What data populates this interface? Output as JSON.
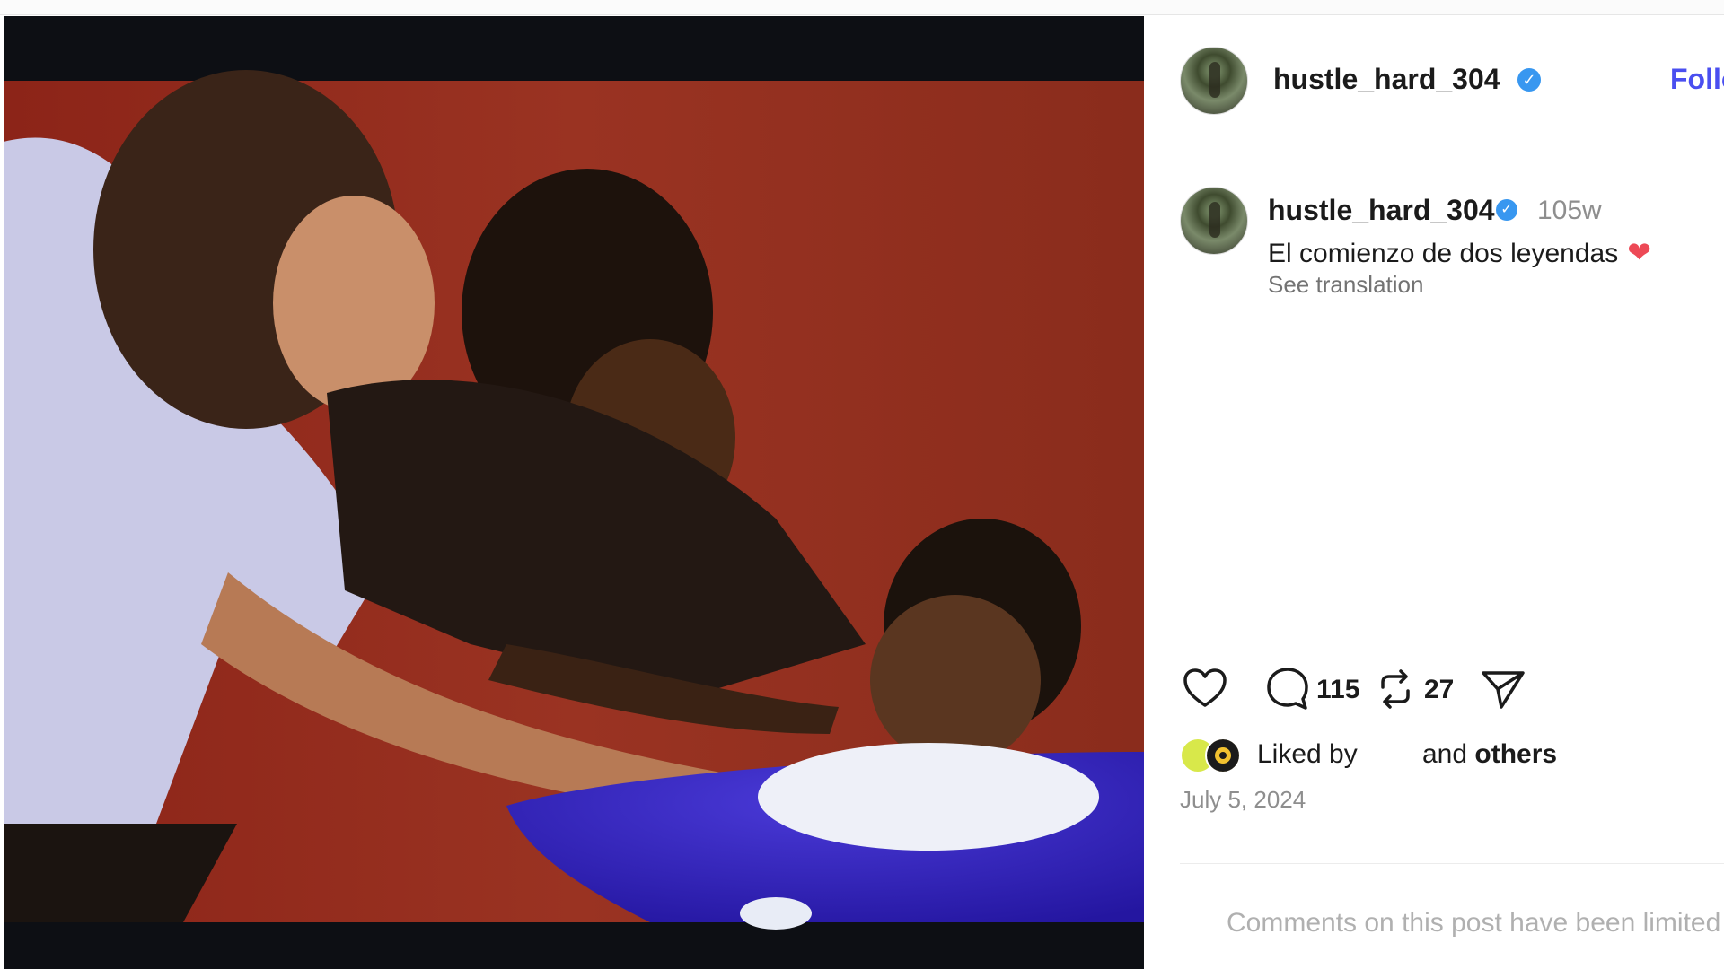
{
  "post": {
    "username": "hustle_hard_304",
    "follow_label": "Follow",
    "time_ago": "105w",
    "caption": "El comienzo de dos leyendas",
    "caption_emoji": "❤",
    "see_translation": "See translation",
    "comment_count": "115",
    "repost_count": "27",
    "liked_by_label": "Liked by",
    "and_label": "and",
    "others_label": "others",
    "date": "July 5, 2024",
    "comments_notice": "Comments on this post have been limited"
  },
  "icons": {
    "like": "heart-icon",
    "comment": "comment-icon",
    "repost": "repost-icon",
    "share": "send-icon",
    "verified": "verified-badge-icon"
  },
  "colors": {
    "accent_follow": "#4a4ff0",
    "verified": "#3897f0",
    "heart": "#ed4956",
    "muted_text": "#8e8e8e"
  }
}
